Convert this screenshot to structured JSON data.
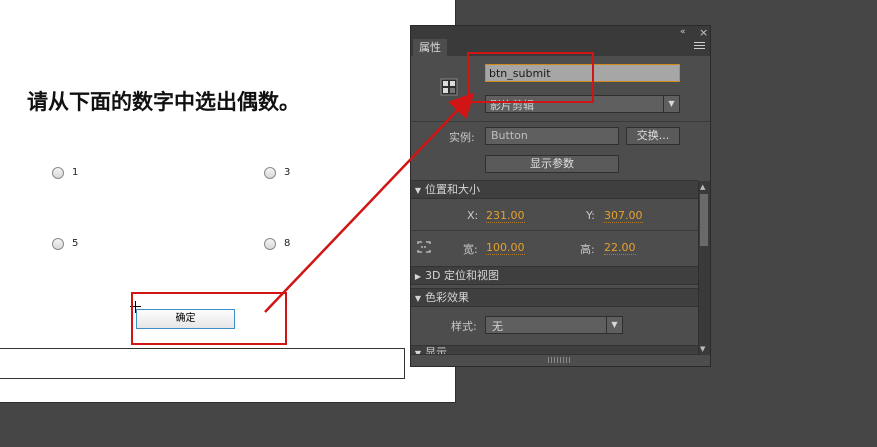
{
  "stage": {
    "question": "请从下面的数字中选出偶数。",
    "options": [
      {
        "label": "1"
      },
      {
        "label": "3"
      },
      {
        "label": "5"
      },
      {
        "label": "8"
      }
    ],
    "submit_label": "确定"
  },
  "panel": {
    "title_tab": "属性",
    "collapse_icon": "«",
    "close_icon": "×",
    "instance_name": "btn_submit",
    "symbol_type": "影片剪辑",
    "instance_label": "实例:",
    "instance_value": "Button",
    "swap_label": "交换...",
    "show_params_label": "显示参数",
    "position_size": {
      "title": "位置和大小",
      "x_label": "X:",
      "x_value": "231.00",
      "y_label": "Y:",
      "y_value": "307.00",
      "width_label": "宽:",
      "width_value": "100.00",
      "height_label": "高:",
      "height_value": "22.00"
    },
    "section_3d": "3D 定位和视图",
    "color_effect": {
      "title": "色彩效果",
      "style_label": "样式:",
      "style_value": "无"
    },
    "display_section": "显示"
  },
  "annotation_color": "#d11414",
  "accent_value_color": "#e6a12a"
}
